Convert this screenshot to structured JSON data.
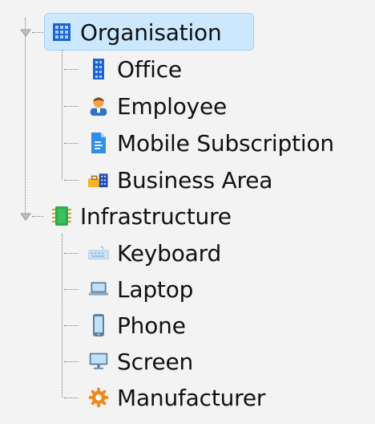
{
  "tree": {
    "groups": [
      {
        "label": "Organisation",
        "icon": "organisation-grid-icon",
        "selected": true,
        "expanded": true,
        "children": [
          {
            "label": "Office",
            "icon": "office-building-icon"
          },
          {
            "label": "Employee",
            "icon": "employee-person-icon"
          },
          {
            "label": "Mobile Subscription",
            "icon": "document-icon"
          },
          {
            "label": "Business Area",
            "icon": "business-area-icon"
          }
        ]
      },
      {
        "label": "Infrastructure",
        "icon": "chip-icon",
        "selected": false,
        "expanded": true,
        "children": [
          {
            "label": "Keyboard",
            "icon": "keyboard-icon"
          },
          {
            "label": "Laptop",
            "icon": "laptop-icon"
          },
          {
            "label": "Phone",
            "icon": "phone-icon"
          },
          {
            "label": "Screen",
            "icon": "monitor-icon"
          },
          {
            "label": "Manufacturer",
            "icon": "gear-icon"
          }
        ]
      }
    ]
  },
  "colors": {
    "selection_bg": "#cce8ff",
    "selection_border": "#99d1ff",
    "background": "#f3f3f3"
  }
}
